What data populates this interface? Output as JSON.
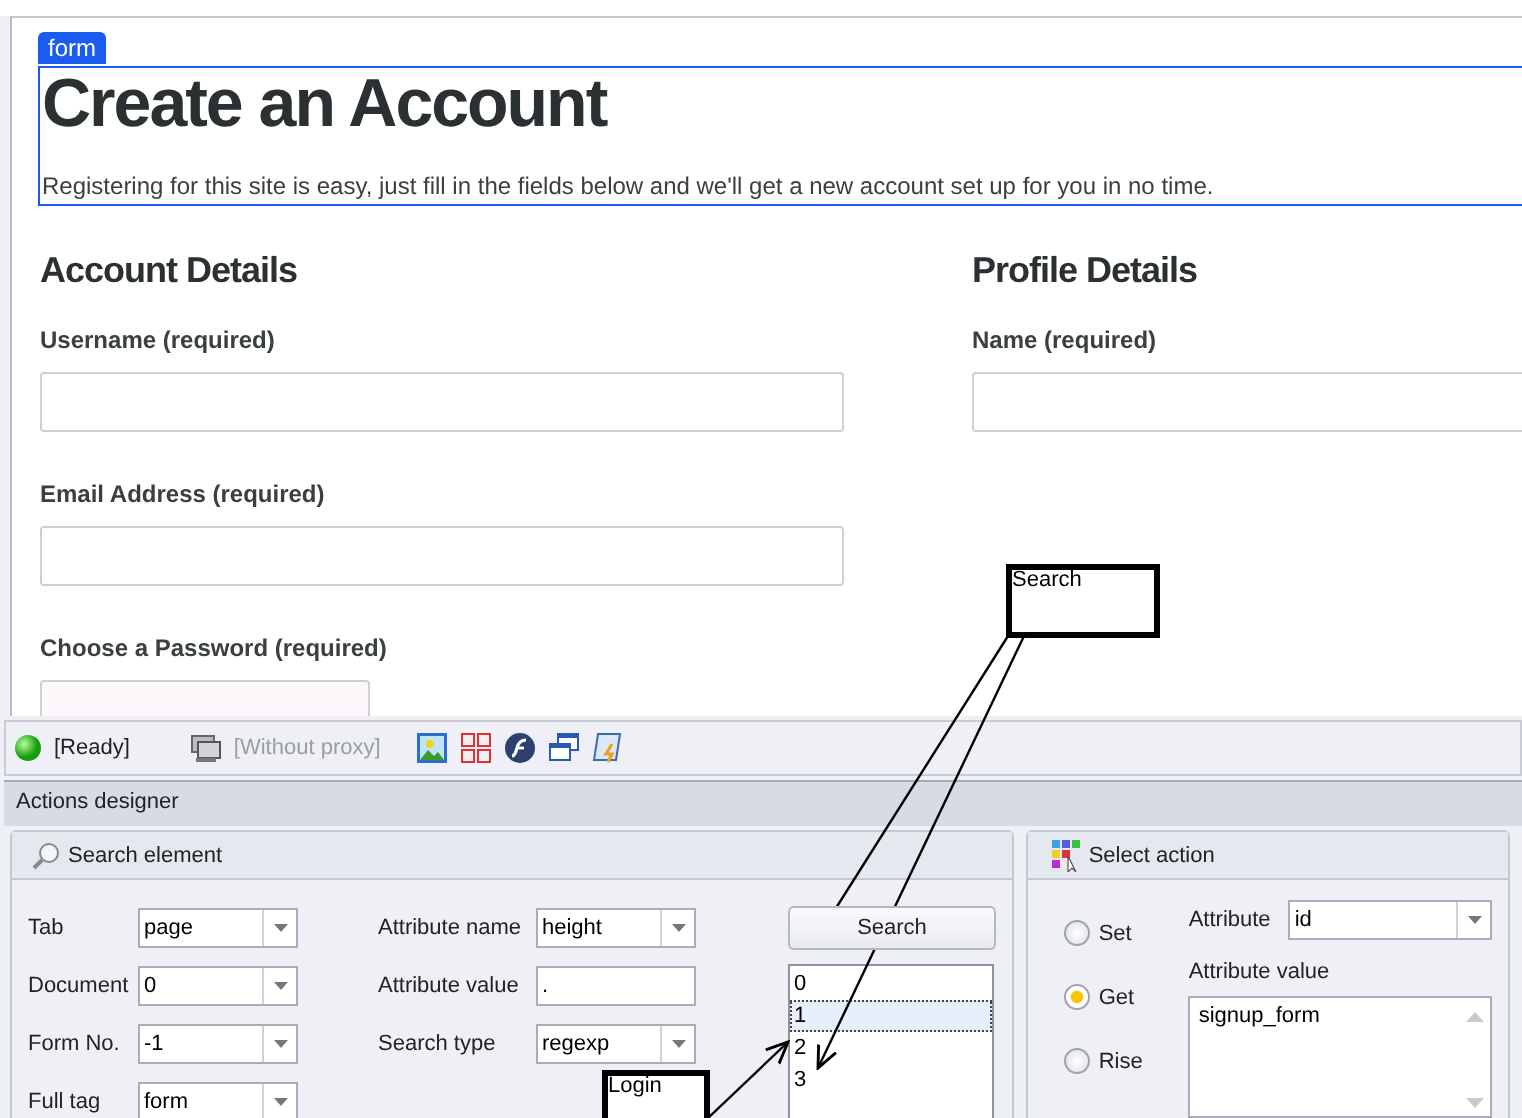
{
  "page": {
    "form_tag": "form",
    "title": "Create an Account",
    "intro": "Registering for this site is easy, just fill in the fields below and we'll get a new account set up for you in no time.",
    "sections": [
      {
        "heading": "Account Details",
        "fields": [
          {
            "label": "Username (required)",
            "kind": "text"
          },
          {
            "label": "Email Address (required)",
            "kind": "text"
          },
          {
            "label": "Choose a Password (required)",
            "kind": "password"
          }
        ]
      },
      {
        "heading": "Profile Details",
        "fields": [
          {
            "label": "Name (required)",
            "kind": "text"
          }
        ]
      }
    ]
  },
  "status_bar": {
    "status": "[Ready]",
    "proxy": "[Without proxy]"
  },
  "designer": {
    "title": "Actions designer",
    "search_panel": {
      "title": "Search element",
      "left_fields": [
        {
          "label": "Tab",
          "value": "page",
          "kind": "dropdown"
        },
        {
          "label": "Document",
          "value": "0",
          "kind": "dropdown"
        },
        {
          "label": "Form No.",
          "value": "-1",
          "kind": "dropdown"
        },
        {
          "label": "Full tag",
          "value": "form",
          "kind": "dropdown"
        }
      ],
      "right_fields": [
        {
          "label": "Attribute name",
          "value": "height",
          "kind": "dropdown"
        },
        {
          "label": "Attribute value",
          "value": ".",
          "kind": "text"
        },
        {
          "label": "Search type",
          "value": "regexp",
          "kind": "dropdown"
        }
      ],
      "search_button": "Search",
      "results": [
        {
          "label": "0",
          "selected": false
        },
        {
          "label": "1",
          "selected": true
        },
        {
          "label": "2",
          "selected": false
        },
        {
          "label": "3",
          "selected": false
        }
      ]
    },
    "action_panel": {
      "title": "Select action",
      "options": [
        {
          "label": "Set",
          "selected": false
        },
        {
          "label": "Get",
          "selected": true
        },
        {
          "label": "Rise",
          "selected": false
        }
      ],
      "attribute_label": "Attribute",
      "attribute": "id",
      "value_label": "Attribute value",
      "value": "signup_form"
    }
  },
  "annotations": [
    {
      "label": "Search"
    },
    {
      "label": "Login"
    }
  ]
}
